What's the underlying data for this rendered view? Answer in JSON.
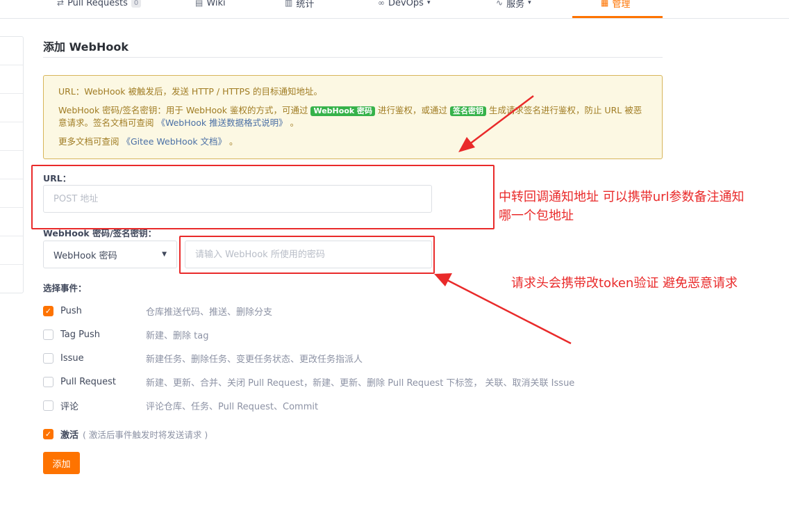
{
  "nav": {
    "items": [
      {
        "icon": "pull-request-icon",
        "glyph": "⇄",
        "label": "Pull Requests",
        "badge": "0"
      },
      {
        "icon": "wiki-icon",
        "glyph": "▤",
        "label": "Wiki"
      },
      {
        "icon": "stats-icon",
        "glyph": "▥",
        "label": "统计"
      },
      {
        "icon": "devops-icon",
        "glyph": "∞",
        "label": "DevOps",
        "caret": "▾"
      },
      {
        "icon": "service-icon",
        "glyph": "∿",
        "label": "服务",
        "caret": "▾"
      },
      {
        "icon": "manage-icon",
        "glyph": "▦",
        "label": "管理"
      }
    ],
    "active_color": "#fe7300"
  },
  "page": {
    "title": "添加 WebHook"
  },
  "notice": {
    "line1": "URL：WebHook 被触发后，发送 HTTP / HTTPS 的目标通知地址。",
    "line2_a": "WebHook 密码/签名密钥：用于 WebHook 鉴权的方式，可通过 ",
    "tag_password": "WebHook 密码",
    "line2_b": " 进行鉴权，或通过 ",
    "tag_sign": "签名密钥",
    "line2_c": " 生成请求签名进行鉴权，防止 URL 被恶意请求。签名文档可查阅 ",
    "link_format": "《WebHook 推送数据格式说明》",
    "line2_d": " 。",
    "line3_a": "更多文档可查阅 ",
    "link_docs": "《Gitee WebHook 文档》",
    "line3_b": " 。"
  },
  "form": {
    "url_label": "URL：",
    "url_placeholder": "POST 地址",
    "secret_label": "WebHook 密码/签名密钥：",
    "secret_type_selected": "WebHook 密码",
    "secret_placeholder": "请输入 WebHook 所使用的密码",
    "events_label": "选择事件：",
    "events": [
      {
        "name": "Push",
        "desc": "仓库推送代码、推送、删除分支",
        "checked": true
      },
      {
        "name": "Tag Push",
        "desc": "新建、删除 tag",
        "checked": false
      },
      {
        "name": "Issue",
        "desc": "新建任务、删除任务、变更任务状态、更改任务指派人",
        "checked": false
      },
      {
        "name": "Pull Request",
        "desc": "新建、更新、合并、关闭 Pull Request，新建、更新、删除 Pull Request 下标签， 关联、取消关联 Issue",
        "checked": false
      },
      {
        "name": "评论",
        "desc": "评论仓库、任务、Pull Request、Commit",
        "checked": false
      }
    ],
    "active_label": "激活",
    "active_hint": "( 激活后事件触发时将发送请求 )",
    "active_checked": true,
    "submit_label": "添加"
  },
  "annotations": {
    "url_note_line1": "中转回调通知地址 可以携带url参数备注通知",
    "url_note_line2": "哪一个包地址",
    "token_note": "请求头会携带改token验证 避免恶意请求",
    "color": "#e92a2a"
  }
}
